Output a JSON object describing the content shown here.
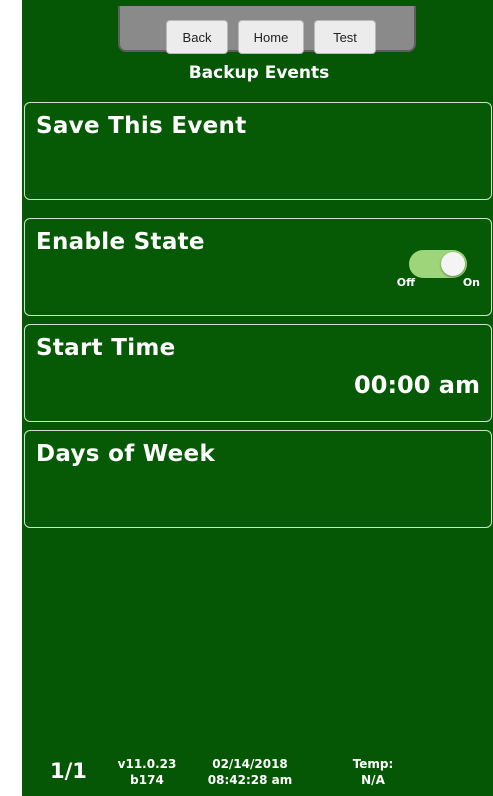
{
  "nav": {
    "back": "Back",
    "home": "Home",
    "test": "Test"
  },
  "page_title": "Backup Events",
  "cards": {
    "save": {
      "label": "Save This Event"
    },
    "enable": {
      "label": "Enable State",
      "toggle_off": "Off",
      "toggle_on": "On",
      "toggle_state": "on"
    },
    "start_time": {
      "label": "Start Time",
      "value": "00:00 am"
    },
    "days": {
      "label": "Days of Week"
    }
  },
  "footer": {
    "page": "1/1",
    "version": "v11.0.23",
    "build": "b174",
    "date": "02/14/2018",
    "time": "08:42:28 am",
    "temp_label": "Temp:",
    "temp_value": "N/A"
  },
  "colors": {
    "background": "#055705",
    "toggle_on": "#9ed47a",
    "nav_tray": "#8a8a8a"
  }
}
